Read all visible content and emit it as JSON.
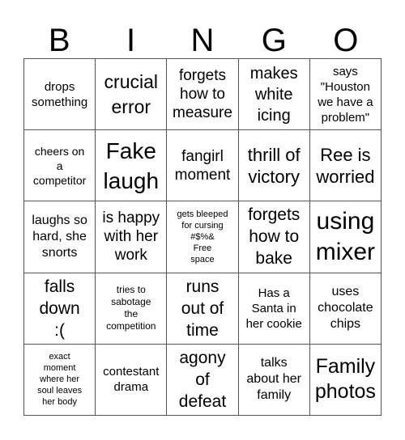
{
  "header": [
    "B",
    "I",
    "N",
    "G",
    "O"
  ],
  "cells": [
    [
      "drops\nsomething",
      "crucial\nerror",
      "forgets\nhow to\nmeasure",
      "makes\nwhite\nicing",
      "says\n\"Houston\nwe have a\nproblem\""
    ],
    [
      "cheers on\na\ncompetitor",
      "Fake\nlaugh",
      "fangirl\nmoment",
      "thrill of\nvictory",
      "Ree is\nworried"
    ],
    [
      "laughs so\nhard, she\nsnorts",
      "is happy\nwith her\nwork",
      "gets bleeped\nfor cursing\n#$%&\nFree\nspace",
      "forgets\nhow to\nbake",
      "using\nmixer"
    ],
    [
      "falls\ndown\n:(",
      "tries to\nsabotage\nthe\ncompetition",
      "runs\nout of\ntime",
      "Has a\nSanta in\nher cookie",
      "uses\nchocolate\nchips"
    ],
    [
      "exact\nmoment\nwhere her\nsoul leaves\nher body",
      "contestant\ndrama",
      "agony\nof\ndefeat",
      "talks\nabout her\nfamily",
      "Family\nphotos"
    ]
  ]
}
